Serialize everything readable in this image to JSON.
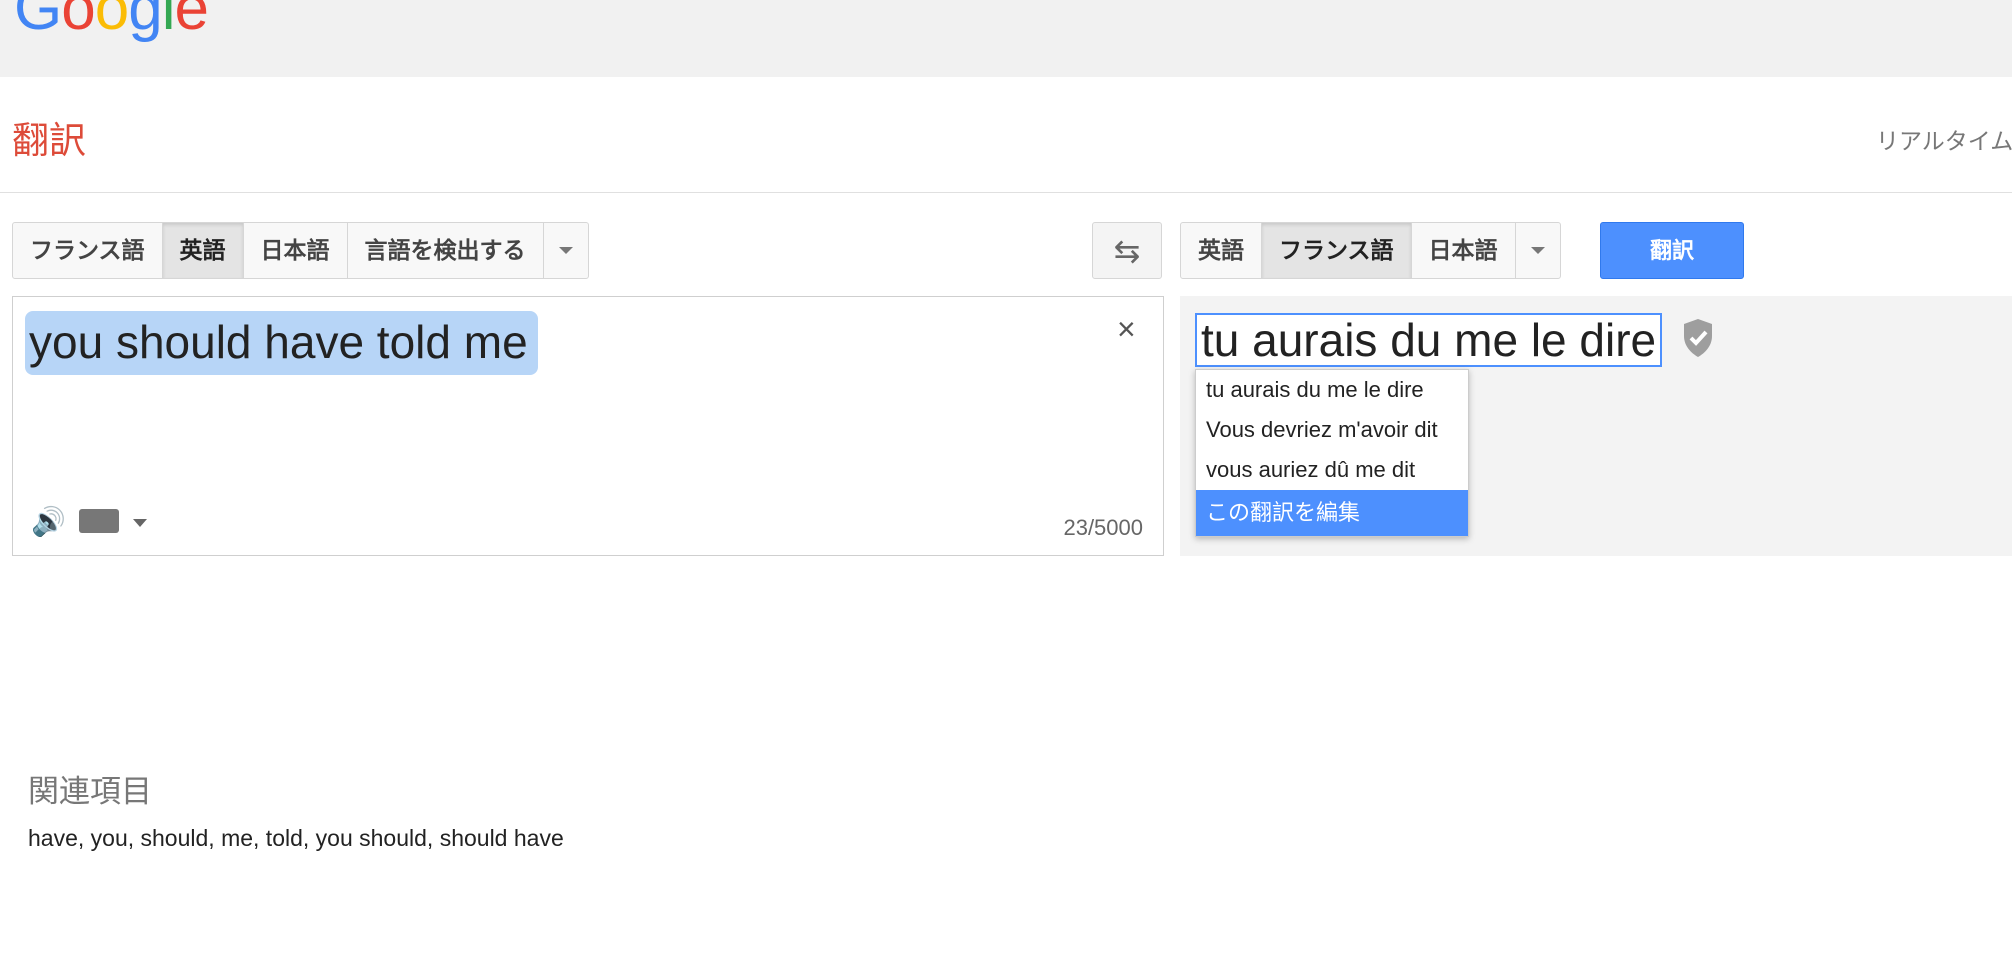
{
  "header": {
    "logo": "Google",
    "title": "翻訳",
    "realtime": "リアルタイム"
  },
  "source_lang": {
    "tabs": [
      "フランス語",
      "英語",
      "日本語",
      "言語を検出する"
    ],
    "selected": "英語"
  },
  "target_lang": {
    "tabs": [
      "英語",
      "フランス語",
      "日本語"
    ],
    "selected": "フランス語"
  },
  "buttons": {
    "swap_icon": "swap-arrows-icon",
    "translate": "翻訳"
  },
  "source": {
    "text": "you should have told me",
    "counter": "23/5000",
    "clear": "×"
  },
  "target": {
    "text": "tu aurais du me le dire",
    "alternatives": [
      "tu aurais du me le dire",
      "Vous devriez m'avoir dit",
      "vous auriez dû me dit"
    ],
    "edit_label": "この翻訳を編集"
  },
  "related": {
    "title": "関連項目",
    "words": "have, you, should, me, told, you should, should have"
  },
  "colors": {
    "accent": "#4d90fe",
    "title_red": "#dd4b39",
    "selection": "#b7d5f7"
  }
}
